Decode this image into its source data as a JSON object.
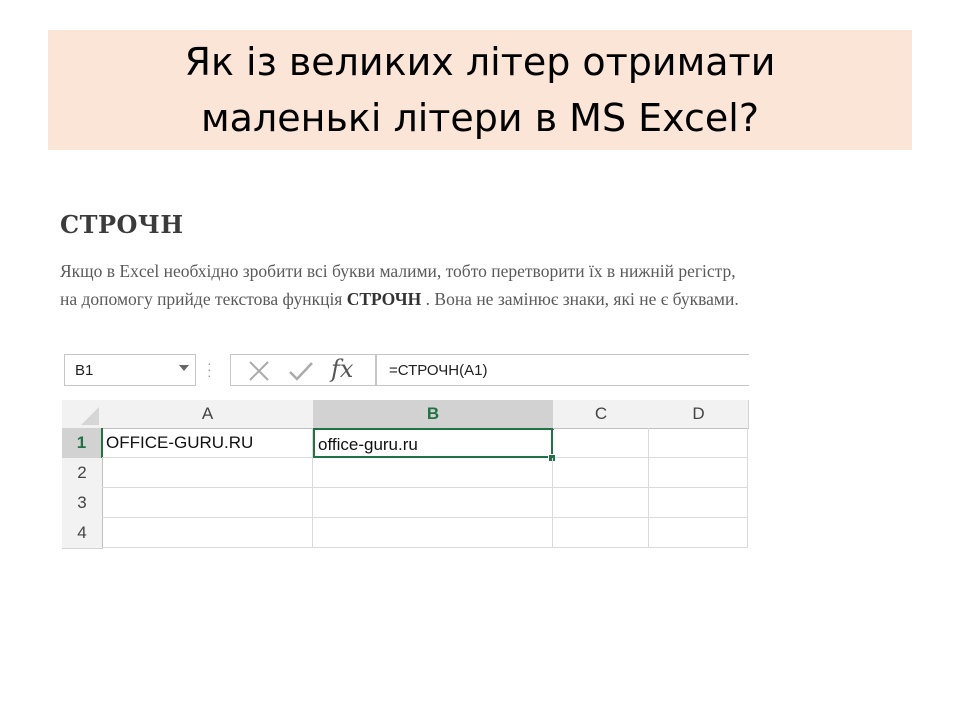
{
  "slide": {
    "title_line1": "Як із великих літер отримати",
    "title_line2": "маленькі літери в MS Excel?"
  },
  "article": {
    "heading": "СТРОЧН",
    "line1": "Якщо в Excel необхідно зробити всі букви малими, тобто перетворити їх в нижній регістр,",
    "line2_start": "на допомогу прийде текстова функція ",
    "line2_func": "СТРОЧН",
    "line2_end": " . Вона не замінює знаки, які не є буквами."
  },
  "formula_bar": {
    "name_box": "B1",
    "formula": "=СТРОЧН(A1)",
    "icons": [
      "cancel-icon",
      "enter-check-icon",
      "insert-function-icon"
    ]
  },
  "sheet": {
    "columns": [
      "A",
      "B",
      "C",
      "D"
    ],
    "rows": [
      "1",
      "2",
      "3",
      "4"
    ],
    "selected_cell": "B1",
    "cells": {
      "A1": "OFFICE-GURU.RU",
      "B1": "office-guru.ru"
    },
    "accent_color": "#217346"
  }
}
